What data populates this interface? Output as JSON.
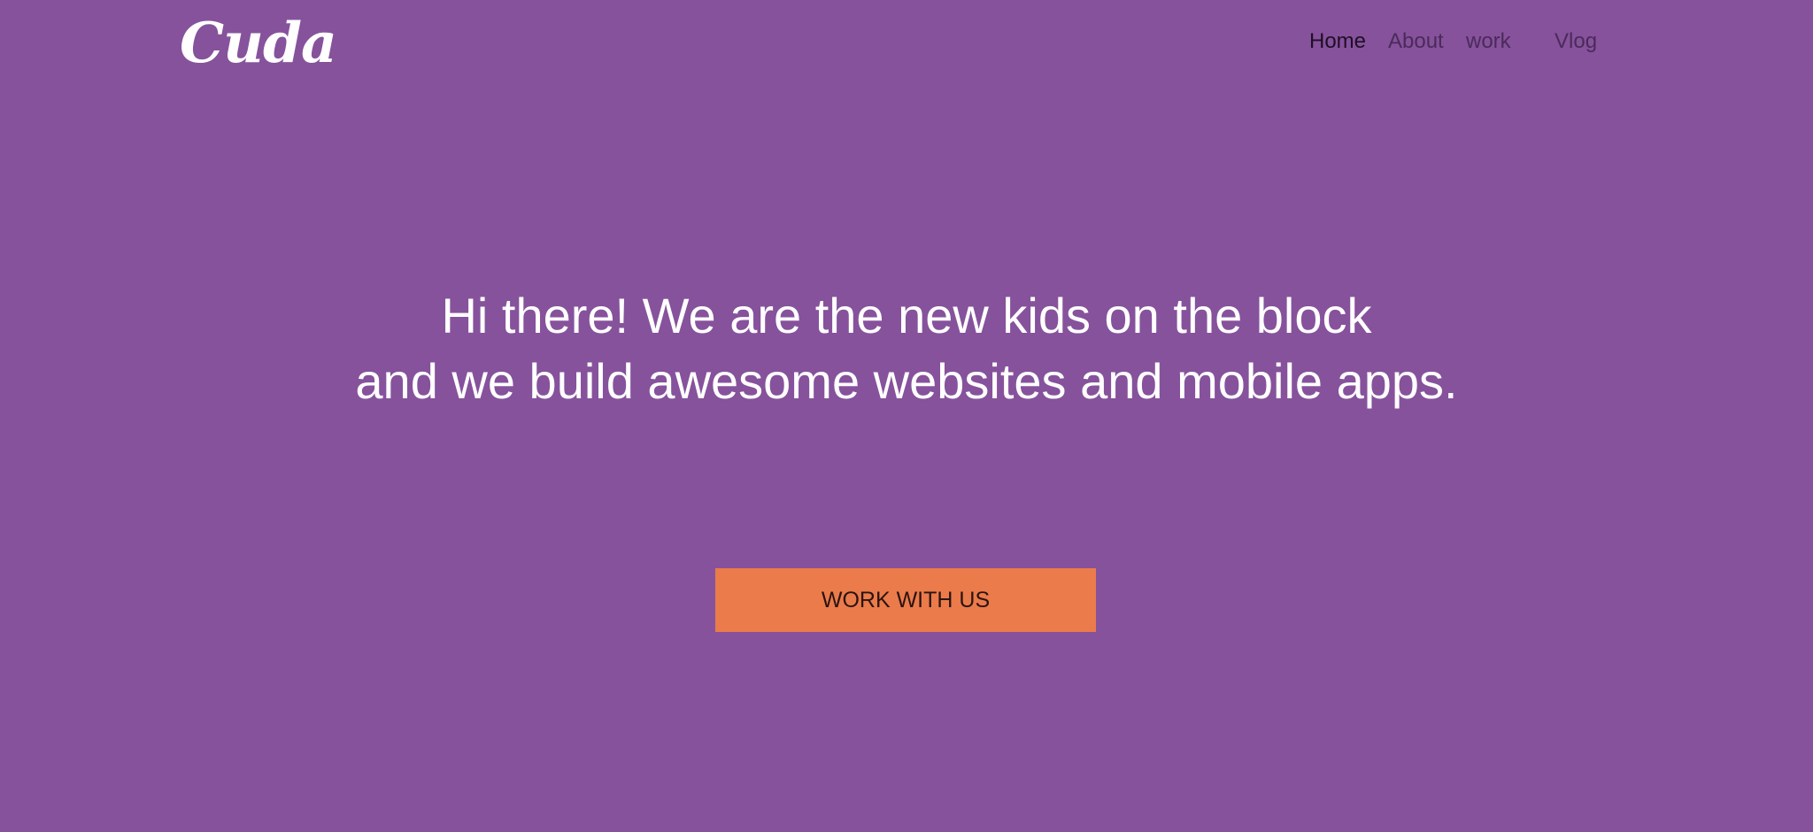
{
  "header": {
    "logo_text": "Cuda",
    "nav": {
      "home": "Home",
      "about": "About",
      "work": "work",
      "vlog": "Vlog"
    }
  },
  "hero": {
    "line1": "Hi there! We are the new kids on the block",
    "line2": "and we build awesome websites and mobile apps.",
    "cta_label": "WORK WITH US"
  },
  "colors": {
    "background": "#86529c",
    "cta_background": "#eb7b4b",
    "text_primary": "#ffffff",
    "nav_active": "#1f0f26",
    "nav_inactive": "#4b2a5a"
  }
}
